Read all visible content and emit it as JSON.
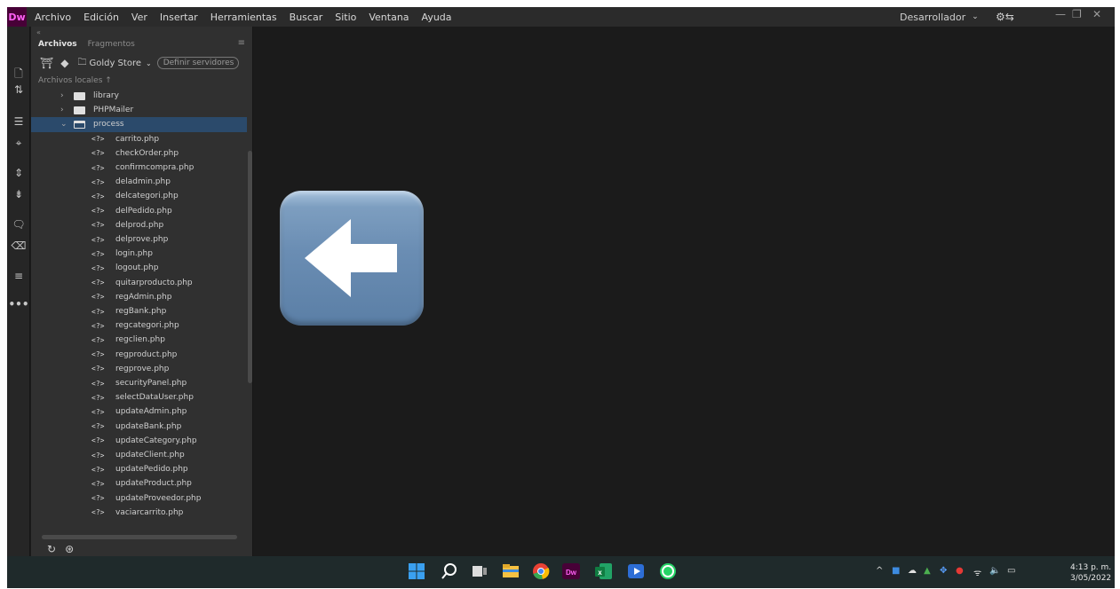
{
  "app": {
    "logo": "Dw",
    "menu": [
      "Archivo",
      "Edición",
      "Ver",
      "Insertar",
      "Herramientas",
      "Buscar",
      "Sitio",
      "Ventana",
      "Ayuda"
    ],
    "workspace": "Desarrollador"
  },
  "panel": {
    "tabs": [
      "Archivos",
      "Fragmentos"
    ],
    "site": "Goldy Store",
    "servers_button": "Definir servidores",
    "local_label": "Archivos locales",
    "folders": [
      {
        "name": "library",
        "open": false
      },
      {
        "name": "PHPMailer",
        "open": false
      },
      {
        "name": "process",
        "open": true,
        "selected": true
      }
    ],
    "file_icon": "<?>",
    "files": [
      "carrito.php",
      "checkOrder.php",
      "confirmcompra.php",
      "deladmin.php",
      "delcategori.php",
      "delPedido.php",
      "delprod.php",
      "delprove.php",
      "login.php",
      "logout.php",
      "quitarproducto.php",
      "regAdmin.php",
      "regBank.php",
      "regcategori.php",
      "regclien.php",
      "regproduct.php",
      "regprove.php",
      "securityPanel.php",
      "selectDataUser.php",
      "updateAdmin.php",
      "updateBank.php",
      "updateCategory.php",
      "updateClient.php",
      "updatePedido.php",
      "updateProduct.php",
      "updateProveedor.php",
      "vaciarcarrito.php"
    ]
  },
  "overlay": {
    "icon": "back-arrow-emoji",
    "color": "#6a8db3"
  },
  "taskbar": {
    "apps": [
      "windows-start",
      "search",
      "task-view",
      "file-explorer",
      "chrome",
      "dreamweaver",
      "excel",
      "media-player",
      "whatsapp"
    ],
    "time": "4:13 p. m.",
    "date": "3/05/2022"
  }
}
